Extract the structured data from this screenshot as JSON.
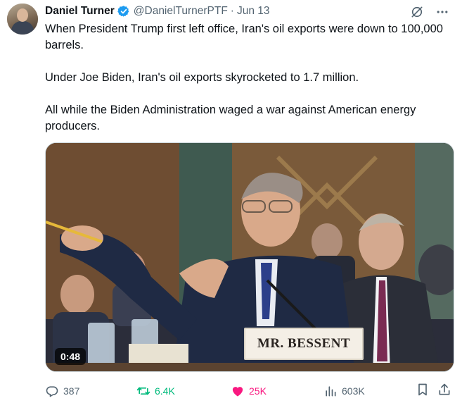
{
  "author": {
    "name": "Daniel Turner",
    "handle": "@DanielTurnerPTF",
    "separator": "·",
    "date": "Jun 13",
    "verified_color": "#1d9bf0"
  },
  "tweet": {
    "paragraphs": [
      "When President Trump first left office, Iran's oil exports were down to 100,000 barrels.",
      "Under Joe Biden, Iran's oil exports skyrocketed to 1.7 million.",
      "All while the Biden Administration waged a war against American energy producers."
    ]
  },
  "media": {
    "video_duration": "0:48",
    "nameplate_text": "MR. BESSENT"
  },
  "actions": {
    "replies": "387",
    "reposts": "6.4K",
    "likes": "25K",
    "views": "603K"
  },
  "icons": {
    "top_right": [
      "grok-icon",
      "more-icon"
    ],
    "action_bar": [
      "reply-icon",
      "repost-icon",
      "like-icon",
      "views-icon",
      "bookmark-icon",
      "share-icon"
    ]
  },
  "colors": {
    "text": "#0f1419",
    "secondary": "#536471",
    "repost_active": "#00ba7c",
    "like_active": "#f91880",
    "border": "#cfd9de"
  }
}
